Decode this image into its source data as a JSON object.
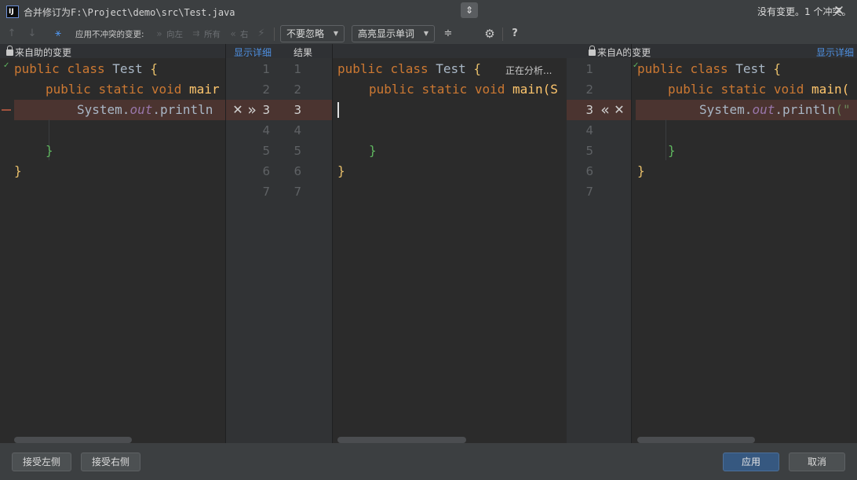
{
  "window": {
    "app_icon_text": "IJ",
    "title": "合并修订为F:\\Project\\demo\\src\\Test.java",
    "close_icon": "close-icon"
  },
  "toolbar": {
    "apply_nonconflict_label": "应用不冲突的变更:",
    "left_label": "向左",
    "all_label": "所有",
    "right_label": "右",
    "ignore_dropdown": "不要忽略",
    "highlight_dropdown": "高亮显示单词",
    "help_label": "?",
    "status": "没有变更。1 个冲突。"
  },
  "panels": {
    "left": {
      "title": "来自助的变更",
      "details_link": "显示详细"
    },
    "center": {
      "title": "结果",
      "analyzing": "正在分析..."
    },
    "right": {
      "title": "来自A的变更",
      "details_link": "显示详细"
    }
  },
  "line_numbers": [
    "1",
    "2",
    "3",
    "4",
    "5",
    "6",
    "7"
  ],
  "code": {
    "l1": {
      "kw1": "public",
      "kw2": "class",
      "name": "Test",
      "brace": "{"
    },
    "l2": {
      "kw1": "public",
      "kw2": "static",
      "kw3": "void"
    },
    "left_l2_tail": "mair",
    "center_l2_tail": "main(S",
    "right_l2_tail": "main(",
    "l3_obj": "System.",
    "l3_field": "out",
    "l3_method": ".println",
    "right_l3_str": "(\"",
    "close_inner": "}",
    "close_outer": "}"
  },
  "merge_buttons": {
    "left_discard": "✕",
    "left_accept": "»",
    "right_accept": "«",
    "right_discard": "✕"
  },
  "buttons": {
    "accept_left": "接受左侧",
    "accept_right": "接受右侧",
    "apply": "应用",
    "cancel": "取消"
  }
}
